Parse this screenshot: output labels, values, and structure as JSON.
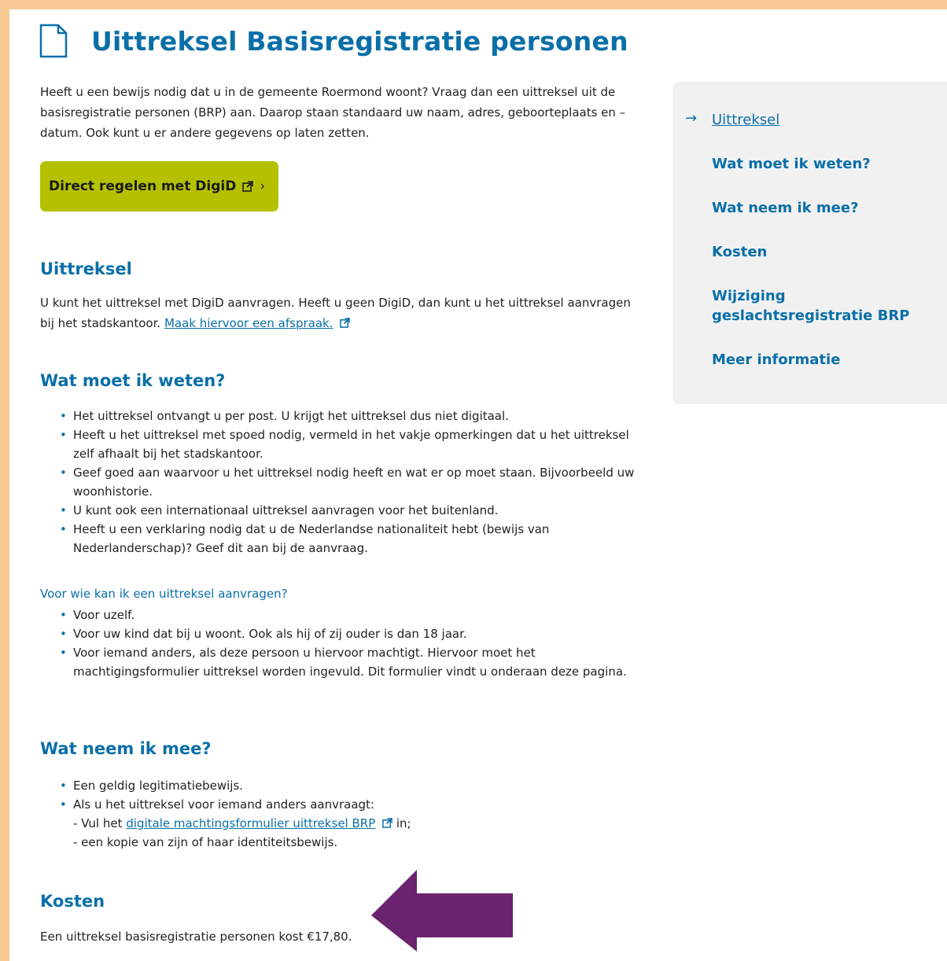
{
  "page": {
    "title": "Uittreksel Basisregistratie personen",
    "intro": "Heeft u een bewijs nodig dat u in de gemeente Roermond woont? Vraag dan een uittreksel uit de basisregistratie personen (BRP) aan. Daarop staan standaard uw naam, adres, geboorteplaats en –datum. Ook kunt u er andere gegevens op laten zetten.",
    "digid_button": "Direct regelen met DigiD",
    "digid_chevron": "›"
  },
  "uittreksel": {
    "heading": "Uittreksel",
    "text": "U kunt het uittreksel met DigiD aanvragen. Heeft u geen DigiD, dan kunt u het uittreksel aanvragen bij het stadskantoor.",
    "link": "Maak hiervoor een afspraak."
  },
  "weten": {
    "heading": "Wat moet ik weten?",
    "items": [
      "Het uittreksel ontvangt u per post. U krijgt het uittreksel dus niet digitaal.",
      "Heeft u het uittreksel met spoed nodig, vermeld in het vakje opmerkingen dat u het uittreksel zelf afhaalt bij het stadskantoor.",
      "Geef goed aan waarvoor u het uittreksel nodig heeft en wat er op moet staan. Bijvoorbeeld uw woonhistorie.",
      "U kunt ook een internationaal uittreksel aanvragen voor het buitenland.",
      "Heeft u een verklaring nodig dat u de Nederlandse nationaliteit hebt (bewijs van Nederlanderschap)? Geef dit aan bij de aanvraag."
    ]
  },
  "voorwie": {
    "heading": "Voor wie kan ik een uittreksel aanvragen?",
    "items": [
      "Voor uzelf.",
      "Voor uw kind dat bij u woont. Ook als hij of zij ouder is dan 18 jaar.",
      "Voor iemand anders, als deze persoon u hiervoor machtigt. Hiervoor moet het machtigingsformulier uittreksel  worden ingevuld. Dit formulier vindt u onderaan deze pagina."
    ]
  },
  "mee": {
    "heading": "Wat neem ik mee?",
    "item1": "Een geldig legitimatiebewijs.",
    "item2": "Als u het uittreksel voor iemand anders aanvraagt:",
    "sub1_prefix": "- Vul het",
    "sub1_link": "digitale machtingsformulier uittreksel BRP",
    "sub1_suffix": "in;",
    "sub2": "- een kopie van zijn of haar identiteitsbewijs."
  },
  "kosten": {
    "heading": "Kosten",
    "text": "Een uittreksel basisregistratie personen kost €17,80."
  },
  "toc": {
    "arrow": "→",
    "items": [
      "Uittreksel",
      "Wat moet ik weten?",
      "Wat neem ik mee?",
      "Kosten",
      "Wijziging geslachtsregistratie BRP",
      "Meer informatie"
    ]
  },
  "colors": {
    "accent": "#0a6fa8",
    "button": "#b5c100",
    "frame": "#f6c993",
    "arrow": "#6a236e"
  }
}
